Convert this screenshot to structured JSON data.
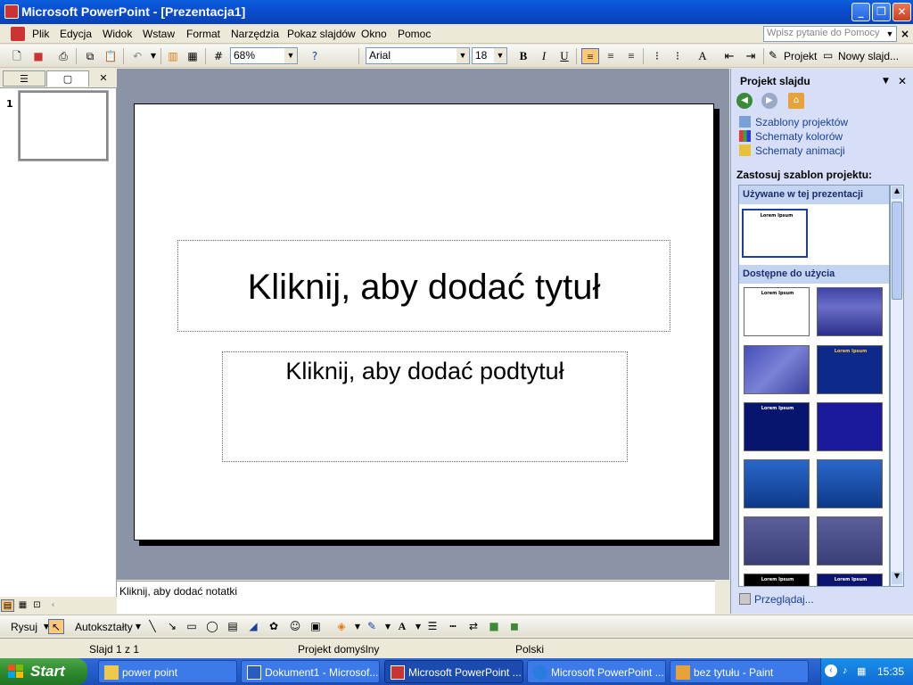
{
  "window": {
    "title": "Microsoft PowerPoint - [Prezentacja1]"
  },
  "menu": {
    "items": [
      "Plik",
      "Edycja",
      "Widok",
      "Wstaw",
      "Format",
      "Narzędzia",
      "Pokaz slajdów",
      "Okno",
      "Pomoc"
    ],
    "help_placeholder": "Wpisz pytanie do Pomocy"
  },
  "toolbar": {
    "zoom": "68%",
    "font": "Arial",
    "font_size": "18",
    "bold": "B",
    "italic": "I",
    "underline": "U",
    "design_label": "Projekt",
    "new_slide_label": "Nowy slajd..."
  },
  "slides_pane": {
    "slide_number": "1"
  },
  "slide": {
    "title_placeholder": "Kliknij, aby dodać tytuł",
    "subtitle_placeholder": "Kliknij, aby dodać podtytuł"
  },
  "notes": {
    "placeholder": "Kliknij, aby dodać notatki"
  },
  "task_pane": {
    "title": "Projekt slajdu",
    "links": [
      "Szablony projektów",
      "Schematy kolorów",
      "Schematy animacji"
    ],
    "apply_label": "Zastosuj szablon projektu:",
    "section_used": "Używane w tej prezentacji",
    "section_available": "Dostępne do użycia",
    "browse": "Przeglądaj...",
    "template_sample_title": "Lorem Ipsum"
  },
  "draw_toolbar": {
    "draw": "Rysuj",
    "autoshapes": "Autokształty"
  },
  "status": {
    "slide": "Slajd 1 z 1",
    "design": "Projekt domyślny",
    "language": "Polski"
  },
  "taskbar": {
    "start": "Start",
    "tasks": [
      "power point",
      "Dokument1 - Microsof...",
      "Microsoft PowerPoint ...",
      "Microsoft PowerPoint ...",
      "bez tytułu - Paint"
    ],
    "clock": "15:35"
  },
  "colors": {
    "titlebar": "#0b4ed0",
    "canvas": "#8b93a7",
    "taskpane": "#d6dff7",
    "taskbar": "#245ecb",
    "start": "#2d8c2d"
  }
}
